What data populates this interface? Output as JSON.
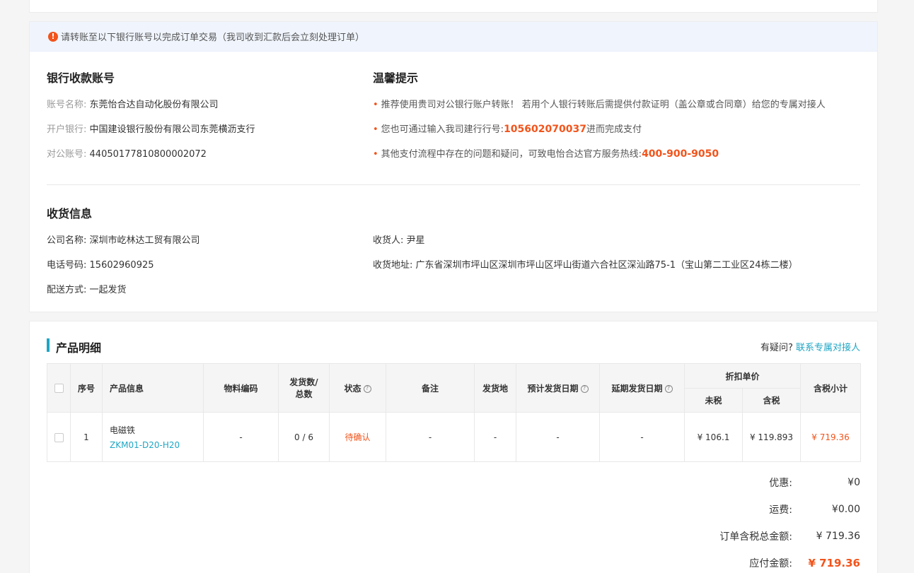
{
  "notice": {
    "text": "请转账至以下银行账号以完成订单交易（我司收到汇款后会立刻处理订单）"
  },
  "bank": {
    "title": "银行收款账号",
    "account_name_label": "账号名称:",
    "account_name": "东莞怡合达自动化股份有限公司",
    "bank_label": "开户银行:",
    "bank": "中国建设银行股份有限公司东莞横沥支行",
    "account_no_label": "对公账号:",
    "account_no": "44050177810800002072"
  },
  "tips": {
    "title": "温馨提示",
    "tip1": "推荐使用贵司对公银行账户转账！ 若用个人银行转账后需提供付款证明（盖公章或合同章）给您的专属对接人",
    "tip2_prefix": "您也可通过输入我司建行行号:",
    "tip2_code": "105602070037",
    "tip2_suffix": "进而完成支付",
    "tip3_prefix": "其他支付流程中存在的问题和疑问，可致电怡合达官方服务热线:",
    "tip3_phone": "400-900-9050"
  },
  "shipping": {
    "title": "收货信息",
    "company_label": "公司名称:",
    "company": "深圳市屹林达工贸有限公司",
    "phone_label": "电话号码:",
    "phone": "15602960925",
    "method_label": "配送方式:",
    "method": "一起发货",
    "receiver_label": "收货人:",
    "receiver": "尹星",
    "address_label": "收货地址:",
    "address": "广东省深圳市坪山区深圳市坪山区坪山街道六合社区深汕路75-1（宝山第二工业区24栋二楼）"
  },
  "products": {
    "title": "产品明细",
    "question_text": "有疑问?",
    "contact_link": "联系专属对接人",
    "headers": {
      "seq": "序号",
      "info": "产品信息",
      "material": "物料编码",
      "ship_qty_1": "发货数/",
      "ship_qty_2": "总数",
      "status": "状态",
      "remark": "备注",
      "origin": "发货地",
      "est_date": "预计发货日期",
      "delay_date": "延期发货日期",
      "unit_price": "折扣单价",
      "no_tax": "未税",
      "with_tax": "含税",
      "subtotal": "含税小计"
    },
    "rows": [
      {
        "seq": "1",
        "name": "电磁铁",
        "model": "ZKM01-D20-H20",
        "material": "-",
        "qty": "0 / 6",
        "status": "待确认",
        "remark": "-",
        "origin": "-",
        "est_date": "-",
        "delay_date": "-",
        "price_no_tax": "¥ 106.1",
        "price_with_tax": "¥ 119.893",
        "subtotal": "¥ 719.36"
      }
    ]
  },
  "summary": {
    "discount_label": "优惠:",
    "discount": "¥0",
    "freight_label": "运费:",
    "freight": "¥0.00",
    "total_label": "订单含税总金额:",
    "total": "¥ 719.36",
    "payable_label": "应付金额:",
    "payable": "¥ 719.36"
  },
  "colors": {
    "accent": "#f2541b",
    "link": "#1fa6c4"
  }
}
